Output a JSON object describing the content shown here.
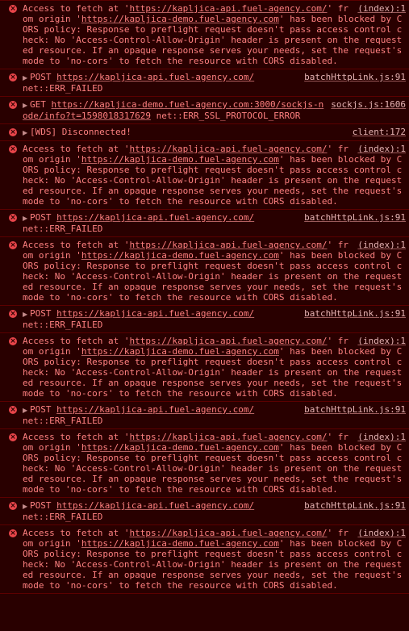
{
  "colors": {
    "background": "#290000",
    "text": "#fe8080",
    "border": "#5c0000",
    "icon": "#e8454a",
    "source_link": "#e5b3b3"
  },
  "icons": {
    "error": "error-x-icon",
    "disclosure": "disclosure-triangle-icon"
  },
  "cors_message": {
    "pre": "Access to fetch at '",
    "url1": "https://kapljica-api.fuel-agency.com/",
    "mid": "' from origin '",
    "url2": "https://kapljica-demo.fuel-agency.com",
    "post": "' has been blocked by CORS policy: Response to preflight request doesn't pass access control check: No 'Access-Control-Allow-Origin' header is present on the requested resource. If an opaque response serves your needs, set the request's mode to 'no-cors' to fetch the resource with CORS disabled.",
    "source": "(index):1"
  },
  "post_message": {
    "method": "POST",
    "url": "https://kapljica-api.fuel-agency.com/",
    "error": "net::ERR_FAILED",
    "source": "batchHttpLink.js:91"
  },
  "get_message": {
    "method": "GET",
    "url": "https://kapljica-demo.fuel-agency.com:3000/sockjs-node/info?t=1598018317629",
    "error": "net::ERR_SSL_PROTOCOL_ERROR",
    "source": "sockjs.js:1606"
  },
  "wds_message": {
    "text": "[WDS] Disconnected!",
    "source": "client:172"
  },
  "entries": [
    "cors",
    "post",
    "get",
    "wds",
    "cors",
    "post",
    "cors",
    "post",
    "cors",
    "post",
    "cors",
    "post",
    "cors"
  ]
}
